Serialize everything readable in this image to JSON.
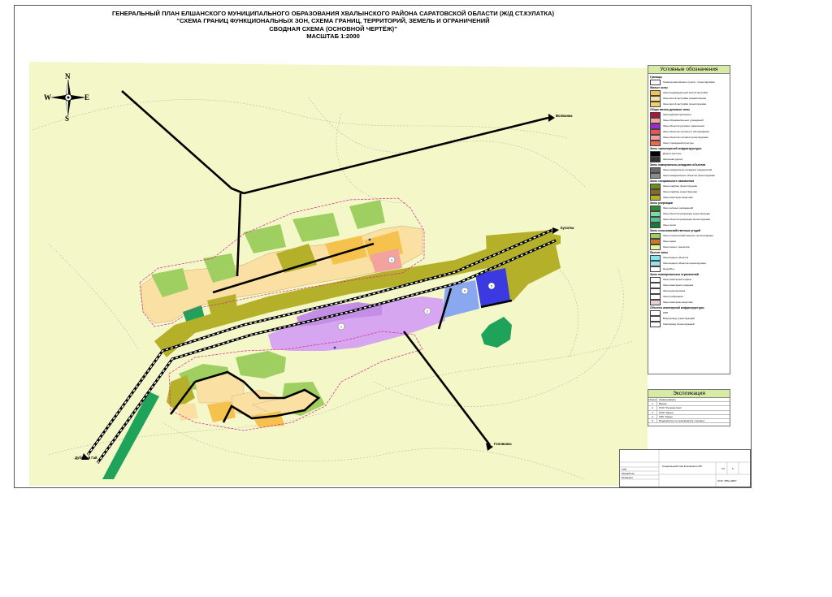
{
  "title": {
    "line1": "ГЕНЕРАЛЬНЫЙ ПЛАН ЕЛШАНСКОГО МУНИЦИПАЛЬНОГО ОБРАЗОВАНИЯ  ХВАЛЫНСКОГО РАЙОНА САРАТОВСКОЙ ОБЛАСТИ (Ж/Д СТ.КУЛАТКА)",
    "line2": "\"СХЕМА ГРАНИЦ ФУНКЦИОНАЛЬНЫХ ЗОН, СХЕМА ГРАНИЦ, ТЕРРИТОРИЙ, ЗЕМЕЛЬ И ОГРАНИЧЕНИЙ",
    "line3": "СВОДНАЯ СХЕМА (ОСНОВНОЙ ЧЕРТЁЖ)\"",
    "line4": "МАСШТАБ 1:2000"
  },
  "compass": {
    "n": "N",
    "s": "S",
    "w": "W",
    "e": "E"
  },
  "map": {
    "background_color": "#f4f7c8",
    "roads": [
      "Волжанка",
      "Кулатка",
      "Голованка",
      "Дубовый Гай"
    ]
  },
  "legend": {
    "title": "Условные обозначения",
    "groups": [
      {
        "name": "Границы",
        "items": [
          {
            "color": "#ffffff",
            "label": "Граница населённого пункта - проектируемая"
          }
        ]
      },
      {
        "name": "Жилые зоны",
        "items": [
          {
            "color": "#f6c24e",
            "label": "Зона индивидуальной жилой застройки"
          },
          {
            "color": "#fbe0a3",
            "label": "Зона жилой застройки разработанная"
          },
          {
            "color": "#f2cf69",
            "label": "Зона жилой застройки проектируемая"
          }
        ]
      },
      {
        "name": "Общественно-деловые зоны",
        "items": [
          {
            "color": "#b3123a",
            "label": "Зона административного"
          },
          {
            "color": "#f2a3a0",
            "label": "Зона образовательных учреждений"
          },
          {
            "color": "#9b2ad0",
            "label": "Зона объектов делового назначения"
          },
          {
            "color": "#e85555",
            "label": "Зона объектов торговли и обслуживания"
          },
          {
            "color": "#f0a0a0",
            "label": "Зона объектов торговли проектируемая"
          },
          {
            "color": "#ec6a4a",
            "label": "Зона учреждений культуры"
          }
        ]
      },
      {
        "name": "Зоны транспортной инфраструктуры",
        "items": [
          {
            "color": "#000000",
            "label": "Дороги местные"
          },
          {
            "color": "#333333",
            "label": "Железная дорога"
          }
        ]
      },
      {
        "name": "Зоны коммунально-складских объектов",
        "items": [
          {
            "color": "#6a6a6a",
            "label": "Зона коммунально-складских предприятий"
          },
          {
            "color": "#8a8a8a",
            "label": "Зона коммунальных объектов проектируемая"
          }
        ]
      },
      {
        "name": "Зоны специального назначения",
        "items": [
          {
            "color": "#6b8c1e",
            "label": "Зона кладбищ проектируемая"
          },
          {
            "color": "#8c6b1e",
            "label": "Зона кладбищ существующая"
          },
          {
            "color": "#b5b02a",
            "label": "Зона санитарно-защитная"
          }
        ]
      },
      {
        "name": "Зоны рекреации",
        "items": [
          {
            "color": "#2e8b2e",
            "label": "Зона зелёных насаждений"
          },
          {
            "color": "#7fd8a6",
            "label": "Зона объектов рекреации существующая"
          },
          {
            "color": "#4fc78c",
            "label": "Зона объектов рекреации проектируемая"
          },
          {
            "color": "#1a7a3a",
            "label": "Зона лесов"
          }
        ]
      },
      {
        "name": "Зоны сельскохозяйственных угодий",
        "items": [
          {
            "color": "#9fcf60",
            "label": "Зона сельскохозяйственного использования"
          },
          {
            "color": "#c87a2a",
            "label": "Зона садов"
          },
          {
            "color": "#e8f39a",
            "label": "Зона пашни, сенокосов"
          }
        ]
      },
      {
        "name": "Прочие зоны",
        "items": [
          {
            "color": "#7fe7ef",
            "label": "Зона водных объектов"
          },
          {
            "color": "#9fe0e8",
            "label": "Зона водных объектов проектируемая"
          },
          {
            "color": "#ffffff",
            "label": "Неудобья"
          }
        ]
      },
      {
        "name": "Зоны планировочных ограничений",
        "items": [
          {
            "color": "#ffffff",
            "label": "Зона санитарной охраны"
          },
          {
            "color": "#ffffff",
            "label": "Зона санитарного разрыва"
          },
          {
            "color": "#ffffff",
            "label": "Зона водоохранная"
          },
          {
            "color": "#ffffff",
            "label": "Зона прибрежная"
          },
          {
            "color": "#e6d2cc",
            "label": "Зона санитарно-защитная"
          }
        ]
      },
      {
        "name": "Объекты инженерной инфраструктуры",
        "items": [
          {
            "color": "#ffffff",
            "label": "ЛЭП"
          },
          {
            "color": "#ffffff",
            "label": "Водопровод существующий"
          },
          {
            "color": "#ffffff",
            "label": "Газопровод проектируемый"
          }
        ]
      }
    ]
  },
  "explication": {
    "title": "Экспликация",
    "header": [
      "Номер",
      "Наименование"
    ],
    "rows": [
      [
        "1",
        "Вокзал"
      ],
      [
        "2",
        "ООО \"Кулатка-Агро\""
      ],
      [
        "3",
        "ООО \"Зерно\""
      ],
      [
        "4",
        "СПК \"Кредо\""
      ],
      [
        "5",
        "Предприятие по производству стеновых"
      ]
    ]
  },
  "stamp": {
    "org": "ООО \"ИПЦ-АВИ\"",
    "sheet_title": "Генеральный план Елшанского МО",
    "stage": "ГП",
    "sheet": "6",
    "sheets": "",
    "rows": [
      "ГИП",
      "Разработал",
      "Проверил"
    ]
  }
}
